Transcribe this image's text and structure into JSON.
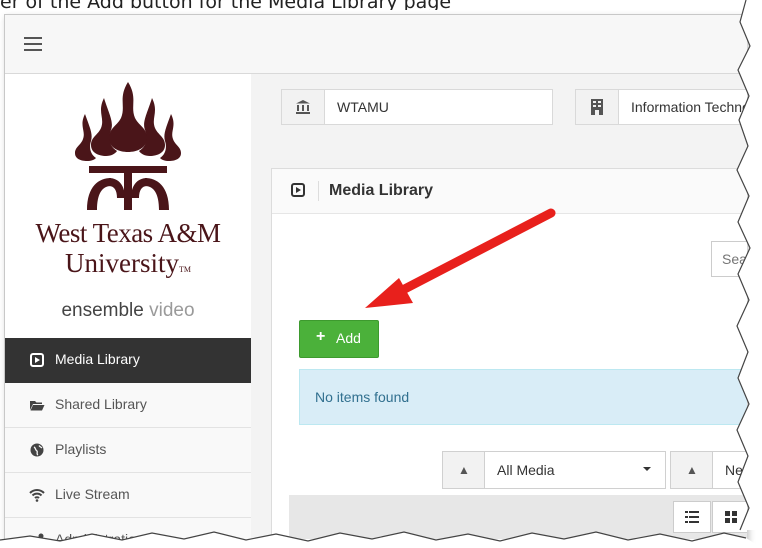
{
  "caption": "er of the Add button for the Media Library page",
  "sidebar": {
    "logo_line1": "West Texas A&M",
    "logo_line2": "University",
    "logo_tm": "TM",
    "brand_strong": "ensemble",
    "brand_light": "video",
    "items": [
      {
        "label": "Media Library",
        "icon": "media-library-icon",
        "active": true
      },
      {
        "label": "Shared Library",
        "icon": "folder-open-icon",
        "active": false
      },
      {
        "label": "Playlists",
        "icon": "globe-icon",
        "active": false
      },
      {
        "label": "Live Stream",
        "icon": "wifi-icon",
        "active": false
      },
      {
        "label": "Administration",
        "icon": "cogs-icon",
        "active": false
      }
    ]
  },
  "filters": {
    "institution": "WTAMU",
    "department": "Information Technology"
  },
  "panel": {
    "title": "Media Library",
    "search_placeholder": "Search",
    "add_label": "Add",
    "empty_message": "No items found",
    "media_type": "All Media",
    "sort_order": "Newest"
  },
  "colors": {
    "active_nav_bg": "#333333",
    "add_button": "#4bb13a",
    "notice_bg": "#d9edf7",
    "brand_maroon": "#4a1519",
    "annotation_arrow": "#e8201c"
  }
}
